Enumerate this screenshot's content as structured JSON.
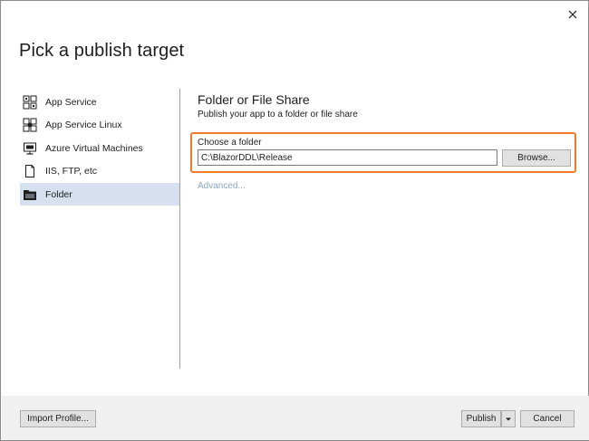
{
  "dialog": {
    "title": "Pick a publish target",
    "close_icon": "close-icon"
  },
  "sidebar": {
    "items": [
      {
        "label": "App Service",
        "icon": "app-service-icon",
        "selected": false
      },
      {
        "label": "App Service Linux",
        "icon": "app-service-linux-icon",
        "selected": false
      },
      {
        "label": "Azure Virtual Machines",
        "icon": "virtual-machine-icon",
        "selected": false
      },
      {
        "label": "IIS, FTP, etc",
        "icon": "document-icon",
        "selected": false
      },
      {
        "label": "Folder",
        "icon": "folder-icon",
        "selected": true
      }
    ]
  },
  "main": {
    "heading": "Folder or File Share",
    "subheading": "Publish your app to a folder or file share",
    "folder_label": "Choose a folder",
    "folder_value": "C:\\BlazorDDL\\Release",
    "browse_label": "Browse...",
    "advanced_label": "Advanced...",
    "highlight_color": "#f07b2a",
    "link_color": "#8aa7c8",
    "selected_bg": "#d6e0ee"
  },
  "footer": {
    "import_label": "Import Profile...",
    "publish_label": "Publish",
    "publish_dropdown_icon": "chevron-down-icon",
    "cancel_label": "Cancel"
  }
}
